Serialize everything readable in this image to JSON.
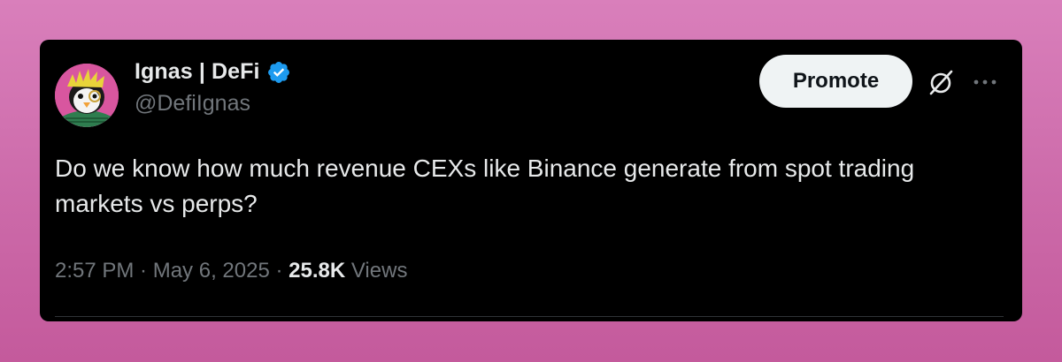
{
  "author": {
    "display_name": "Ignas | DeFi",
    "handle": "@DefiIgnas",
    "verified_icon": "verified-badge-icon",
    "verified_color": "#1d9bf0"
  },
  "actions": {
    "promote_label": "Promote",
    "grok_icon": "grok-icon",
    "more_icon": "more-options-icon"
  },
  "tweet": {
    "text": "Do we know how much revenue CEXs like Binance generate from spot trading markets vs perps?"
  },
  "meta": {
    "time": "2:57 PM",
    "sep1": " · ",
    "date": "May 6, 2025",
    "sep2": " · ",
    "views_count": "25.8K",
    "views_label": " Views"
  },
  "colors": {
    "card_bg": "#000000",
    "text_primary": "#e7e9ea",
    "text_secondary": "#71767b",
    "button_bg": "#eff3f4",
    "page_bg": "#d97fbb"
  }
}
